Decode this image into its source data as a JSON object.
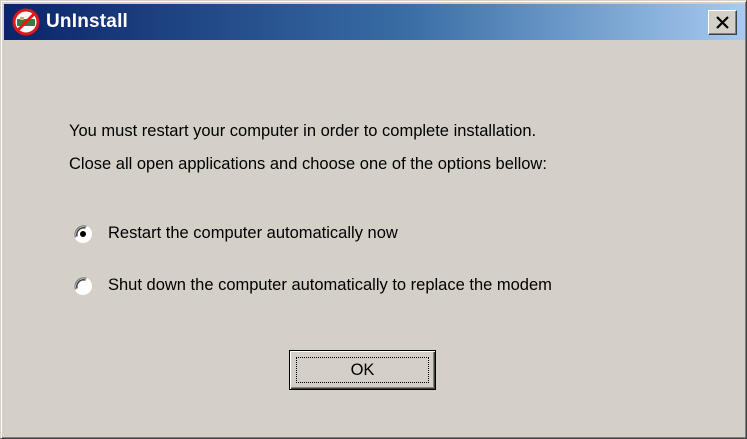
{
  "window": {
    "title": "UnInstall",
    "icon": "uninstall-icon"
  },
  "dialog": {
    "message_line1": "You must restart your computer in order to complete installation.",
    "message_line2": "Close all open applications and choose one of the options bellow:",
    "options": [
      {
        "label": "Restart the computer automatically now",
        "selected": true
      },
      {
        "label": "Shut down the computer automatically to replace the modem",
        "selected": false
      }
    ],
    "ok_label": "OK"
  },
  "colors": {
    "titlebar_start": "#0a246a",
    "titlebar_end": "#a6caf0",
    "face": "#d4d0c8"
  }
}
